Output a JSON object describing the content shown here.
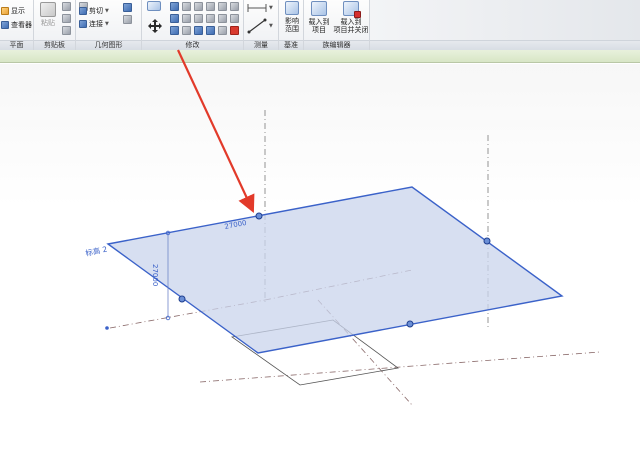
{
  "ribbon": {
    "panels": {
      "plan": {
        "label": "平面",
        "show": "显示",
        "viewer": "查看器"
      },
      "clipboard": {
        "label": "剪贴板",
        "paste": "粘贴"
      },
      "geometry": {
        "label": "几何图形",
        "cut": "剪切",
        "join": "连接"
      },
      "modify": {
        "label": "修改"
      },
      "measure": {
        "label": "测量"
      },
      "datum": {
        "label": "基准",
        "scope_line1": "影响",
        "scope_line2": "范围"
      },
      "family_editor": {
        "label": "族编辑器",
        "load_line1": "载入到",
        "load_line2": "项目",
        "load_close_line1": "载入到",
        "load_close_line2": "项目并关闭"
      }
    }
  },
  "canvas": {
    "level_label": "标高 2",
    "dim_top": "27000",
    "dim_side": "27000"
  },
  "colors": {
    "selection": "#3b62c9",
    "plane_fill": "#c9d4ec",
    "arrow": "#e23a2a",
    "strip": "#dbe8ca",
    "reference_lines": "#8a6a6a"
  }
}
